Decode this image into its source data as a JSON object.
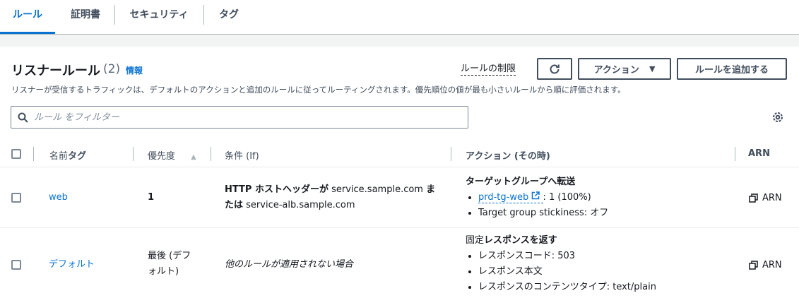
{
  "tabs": [
    {
      "label": "ルール",
      "active": true
    },
    {
      "label": "証明書",
      "active": false
    },
    {
      "label": "セキュリティ",
      "active": false
    },
    {
      "label": "タグ",
      "active": false
    }
  ],
  "header": {
    "title": "リスナールール",
    "count": "(2)",
    "info_link": "情報",
    "limits_link": "ルールの制限",
    "actions_label": "アクション",
    "add_rule_label": "ルールを追加する",
    "description": "リスナーが受信するトラフィックは、デフォルトのアクションと追加のルールに従ってルーティングされます。優先順位の値が最も小さいルールから順に評価されます。"
  },
  "filter": {
    "placeholder": "ルール をフィルター",
    "value": ""
  },
  "table": {
    "columns": {
      "name_tag": "名前タグ",
      "priority": "優先度",
      "conditions": "条件 (If)",
      "actions": "アクション (その時)",
      "arn": "ARN"
    },
    "rows": [
      {
        "name": "web",
        "priority": "1",
        "condition_prefix": "HTTP ホストヘッダーが",
        "condition_value1": "service.sample.com",
        "condition_or": "ま",
        "condition_or2": "たは",
        "condition_value2": "service-alb.sample.com",
        "action_title": "ターゲットグループへ転送",
        "tg_link": "prd-tg-web",
        "tg_weight": ": 1 (100%)",
        "stickiness": "Target group stickiness: オフ",
        "arn": "ARN"
      },
      {
        "name": "デフォルト",
        "priority_line1": "最後 (デフ",
        "priority_line2": "ォルト)",
        "condition": "他のルールが適用されない場合",
        "action_title_a": "固定",
        "action_title_b": "レスポンスを返す",
        "response_code": "レスポンスコード: 503",
        "response_body": "レスポンス本文",
        "content_type": "レスポンスのコンテンツタイプ: text/plain",
        "arn": "ARN"
      }
    ]
  },
  "colors": {
    "accent": "#0972d3",
    "text": "#16191f",
    "muted": "#414d5c",
    "border": "#7d8998"
  }
}
